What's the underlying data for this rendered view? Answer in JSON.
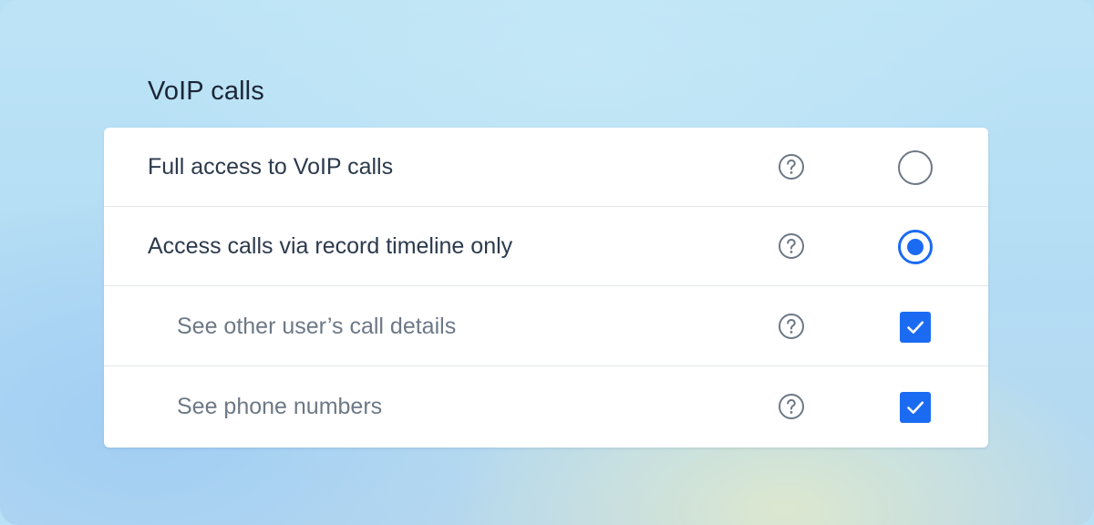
{
  "section": {
    "title": "VoIP calls"
  },
  "options": [
    {
      "label": "Full access to VoIP calls",
      "control": "radio",
      "selected": false,
      "help_icon": "question-circle-icon"
    },
    {
      "label": "Access calls via record timeline only",
      "control": "radio",
      "selected": true,
      "help_icon": "question-circle-icon"
    },
    {
      "label": "See other user’s call details",
      "control": "checkbox",
      "checked": true,
      "help_icon": "question-circle-icon"
    },
    {
      "label": "See phone numbers",
      "control": "checkbox",
      "checked": true,
      "help_icon": "question-circle-icon"
    }
  ],
  "colors": {
    "accent": "#1b6bf2",
    "title_text": "#1b2636",
    "primary_text": "#2c3a4c",
    "secondary_text": "#6d7886",
    "divider": "#e2e6eb"
  }
}
